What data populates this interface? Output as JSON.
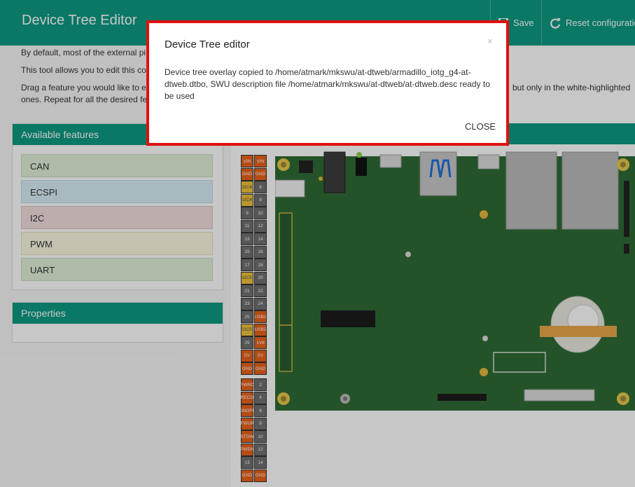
{
  "app": {
    "title": "Device Tree Editor"
  },
  "toolbar": {
    "save_label": "Save",
    "reset_label": "Reset configuration"
  },
  "intro": {
    "p1": "By default, most of the external pir",
    "p2": "This tool allows you to edit this cor",
    "p3a": "Drag a feature you would like to ex",
    "p3b": "but only in the white-highlighted",
    "p3c": "ones. Repeat for all the desired fe"
  },
  "features": {
    "title": "Available features",
    "items": [
      "CAN",
      "ECSPI",
      "I2C",
      "PWM",
      "UART"
    ]
  },
  "properties": {
    "title": "Properties"
  },
  "modal": {
    "title": "Device Tree editor",
    "close_x": "×",
    "message": "Device tree overlay copied to /home/atmark/mkswu/at-dtweb/armadillo_iotg_g4-at-dtweb.dtbo, SWU description file /home/atmark/mkswu/at-dtweb/at-dtweb.desc ready to be used",
    "close_label": "CLOSE"
  },
  "pins": {
    "upper": [
      [
        "VIN",
        "VIN"
      ],
      [
        "GND",
        "GND"
      ],
      [
        "I2C4",
        "6"
      ],
      [
        "I2C4",
        "8"
      ],
      [
        "9",
        "10"
      ],
      [
        "11",
        "12"
      ],
      [
        "13",
        "14"
      ],
      [
        "15",
        "16"
      ],
      [
        "17",
        "18"
      ],
      [
        "I2C5",
        "20"
      ],
      [
        "21",
        "22"
      ],
      [
        "23",
        "24"
      ],
      [
        "25",
        "USB2"
      ],
      [
        "I2C5",
        "USB2"
      ],
      [
        "29",
        "1V8"
      ],
      [
        "5V",
        "5V"
      ],
      [
        "GND",
        "GND"
      ]
    ],
    "lower": [
      [
        "PWRO",
        "2"
      ],
      [
        "RECO",
        "4"
      ],
      [
        "ONOFF",
        "6"
      ],
      [
        "FWUP",
        "8"
      ],
      [
        "STDW",
        "10"
      ],
      [
        "PWDN",
        "12"
      ],
      [
        "13",
        "14"
      ],
      [
        "GND",
        "GND"
      ]
    ]
  },
  "colors": {
    "accent": "#0e9a82",
    "highlight": "#e01010",
    "pin_orange": "#e8621a",
    "pin_gray": "#707070",
    "pin_yellow": "#f0c33c",
    "board_green": "#2f6b35"
  }
}
